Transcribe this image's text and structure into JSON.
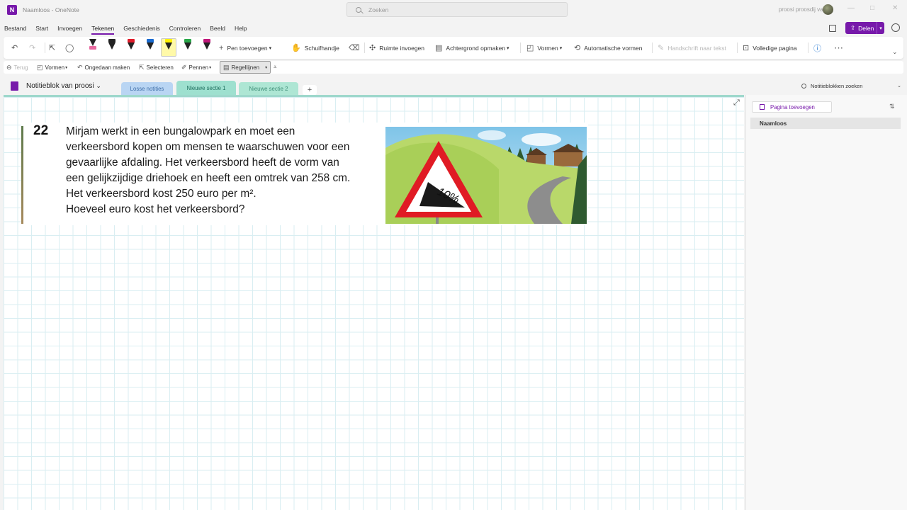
{
  "titlebar": {
    "app_title": "Naamloos - OneNote",
    "search_placeholder": "Zoeken",
    "user_name": "proosi proosdij van"
  },
  "menu": {
    "items": [
      "Bestand",
      "Start",
      "Invoegen",
      "Tekenen",
      "Geschiedenis",
      "Controleren",
      "Beeld",
      "Help"
    ],
    "active": "Tekenen",
    "share_label": "Delen"
  },
  "ribbon": {
    "add_pen": "Pen toevoegen",
    "pan": "Schuifhandje",
    "insert_space": "Ruimte invoegen",
    "background": "Achtergrond opmaken",
    "shapes": "Vormen",
    "auto_shapes": "Automatische vormen",
    "ink_to_text": "Handschrift naar tekst",
    "full_page": "Volledige pagina",
    "pens": [
      {
        "name": "pen-black-pink",
        "band": "#e86aa0"
      },
      {
        "name": "pen-black-1",
        "band": "#222222"
      },
      {
        "name": "pen-red",
        "band": "#e01b2a"
      },
      {
        "name": "pen-blue",
        "band": "#1a6bd0"
      },
      {
        "name": "highlighter-yellow",
        "band": "#fff200"
      },
      {
        "name": "pen-green",
        "band": "#2aa84a"
      },
      {
        "name": "pen-purple",
        "band": "#c0187a"
      }
    ]
  },
  "toolbar2": {
    "back": "Terug",
    "shapes": "Vormen",
    "undo": "Ongedaan maken",
    "select": "Selecteren",
    "pens": "Pennen",
    "ruled_lines": "Regellijnen"
  },
  "notebook": {
    "name": "Notitieblok van proosi",
    "search_label": "Notitieblokken zoeken",
    "sections": [
      {
        "label": "Losse notities",
        "color": "#b9d5f3",
        "text_color": "#3f6ea8"
      },
      {
        "label": "Nieuwe sectie 1",
        "color": "#9ee0cf",
        "text_color": "#1f6f5e"
      },
      {
        "label": "Nieuwe sectie 2",
        "color": "#aee6d4",
        "text_color": "#3f8f78"
      }
    ]
  },
  "question": {
    "number": "22",
    "lines": [
      "Mirjam werkt in een bungalowpark en moet een",
      "verkeersbord kopen om mensen te waarschuwen voor een",
      "gevaarlijke afdaling. Het verkeersbord heeft de vorm van",
      "een gelijkzijdige driehoek en heeft een omtrek van 258 cm.",
      "Het verkeersbord kost 250 euro per m².",
      "Hoeveel euro kost het verkeersbord?"
    ],
    "sign_text": "10%"
  },
  "pages_pane": {
    "add_page": "Pagina toevoegen",
    "pages": [
      "Naamloos"
    ]
  }
}
